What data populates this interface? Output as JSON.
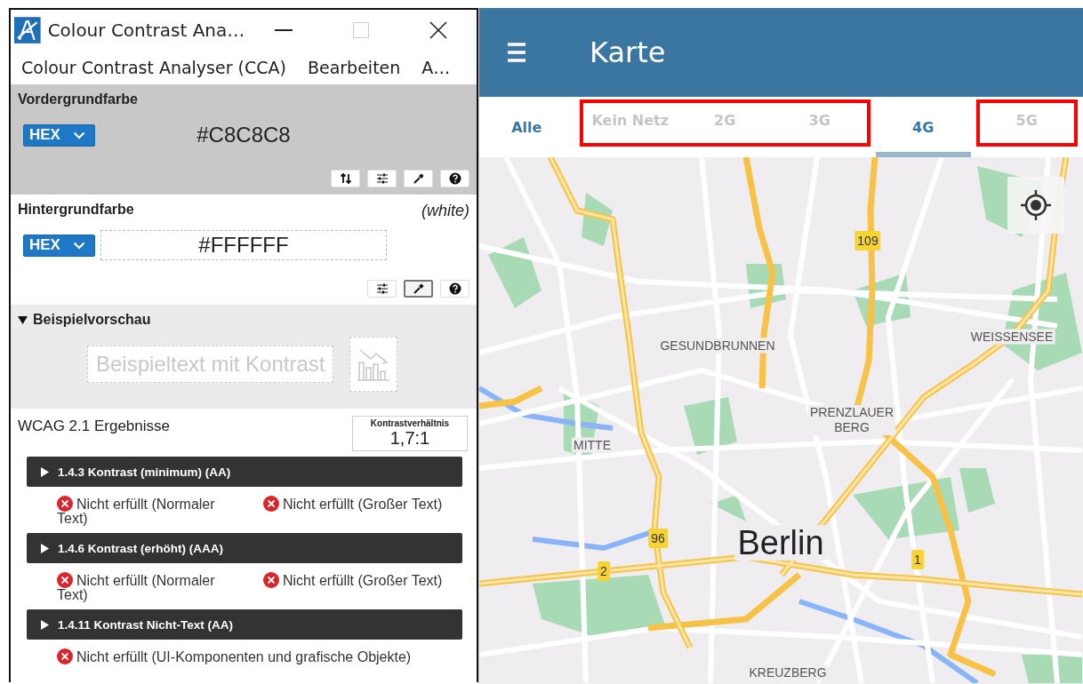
{
  "window": {
    "title": "Colour Contrast Ana…"
  },
  "menu": [
    {
      "label": "Colour Contrast Analyser (CCA)"
    },
    {
      "label": "Bearbeiten"
    },
    {
      "label": "A…"
    }
  ],
  "foreground": {
    "label": "Vordergrundfarbe",
    "format": "HEX",
    "value": "#C8C8C8",
    "tools": [
      {
        "kind": "swap",
        "selected": false
      },
      {
        "kind": "sliders",
        "selected": false
      },
      {
        "kind": "eyedropper",
        "selected": false
      },
      {
        "kind": "help",
        "selected": false
      }
    ]
  },
  "background": {
    "label": "Hintergrundfarbe",
    "color_name": "(white)",
    "format": "HEX",
    "value": "#FFFFFF",
    "tools": [
      {
        "kind": "sliders",
        "selected": false
      },
      {
        "kind": "eyedropper",
        "selected": true
      },
      {
        "kind": "help",
        "selected": false
      }
    ]
  },
  "preview": {
    "title": "Beispielvorschau",
    "expanded": true,
    "sample_text": "Beispieltext mit Kontrast"
  },
  "results": {
    "title": "WCAG 2.1 Ergebnisse",
    "ratio_label": "Kontrastverhältnis",
    "ratio": "1,7:1",
    "criteria": [
      {
        "title": "1.4.3 Kontrast (minimum) (AA)",
        "expanded": false,
        "outcomes": [
          {
            "text": "Nicht erfüllt (Normaler Text)",
            "passed": false
          },
          {
            "text": "Nicht erfüllt (Großer Text)",
            "passed": false
          }
        ]
      },
      {
        "title": "1.4.6 Kontrast (erhöht) (AAA)",
        "expanded": false,
        "outcomes": [
          {
            "text": "Nicht erfüllt (Normaler Text)",
            "passed": false
          },
          {
            "text": "Nicht erfüllt (Großer Text)",
            "passed": false
          }
        ]
      },
      {
        "title": "1.4.11 Kontrast Nicht-Text (AA)",
        "expanded": false,
        "outcomes": [
          {
            "text": "Nicht erfüllt (UI-Komponenten und grafische Objekte)",
            "passed": false
          }
        ]
      }
    ]
  },
  "app": {
    "title": "Karte",
    "tabs": [
      {
        "label": "Alle",
        "selected": false,
        "disabled": false,
        "highlighted": false
      },
      {
        "label": "Kein Netz",
        "selected": false,
        "disabled": true,
        "highlighted": true
      },
      {
        "label": "2G",
        "selected": false,
        "disabled": true,
        "highlighted": true
      },
      {
        "label": "3G",
        "selected": false,
        "disabled": true,
        "highlighted": true
      },
      {
        "label": "4G",
        "selected": true,
        "disabled": false,
        "highlighted": false
      },
      {
        "label": "5G",
        "selected": false,
        "disabled": true,
        "highlighted": true
      }
    ],
    "map": {
      "labels": [
        {
          "kind": "shield",
          "text": "109"
        },
        {
          "kind": "district",
          "text": "WEISSENSEE"
        },
        {
          "kind": "district",
          "text": "GESUNDBRUNNEN"
        },
        {
          "kind": "district",
          "text": "PRENZLAUER BERG"
        },
        {
          "kind": "district",
          "text": "MITTE"
        },
        {
          "kind": "shield",
          "text": "96"
        },
        {
          "kind": "city",
          "text": "Berlin"
        },
        {
          "kind": "shield",
          "text": "2"
        },
        {
          "kind": "shield",
          "text": "1"
        },
        {
          "kind": "district",
          "text": "KREUZBERG"
        }
      ]
    }
  }
}
